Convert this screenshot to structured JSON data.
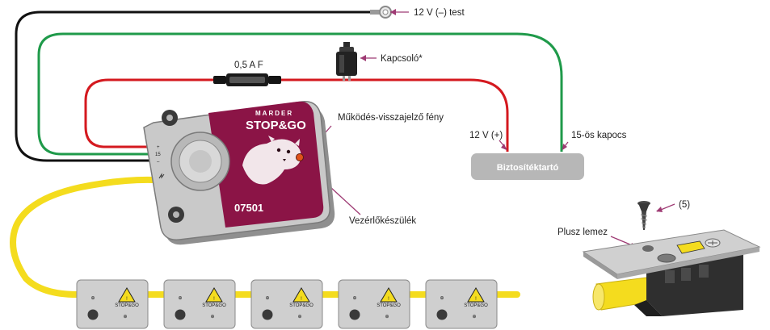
{
  "labels": {
    "test": "12 V (–) test",
    "fuse": "0,5 A F",
    "switch": "Kapcsoló*",
    "led": "Működés-visszajelző fény",
    "plus12": "12 V (+)",
    "terminal15": "15-ös kapocs",
    "fusebox": "Biztosítéktartó",
    "controller": "Vezérlőkészülék",
    "screw_count": "(5)",
    "plate": "Plusz lemez"
  },
  "device": {
    "brand_top": "MARDER",
    "brand_main": "STOP&GO",
    "model": "07501",
    "pin_plus": "+",
    "pin_15": "15",
    "pin_minus": "–"
  },
  "plates": {
    "items": [
      {
        "warn": "STOP&GO"
      },
      {
        "warn": "STOP&GO"
      },
      {
        "warn": "STOP&GO"
      },
      {
        "warn": "STOP&GO"
      },
      {
        "warn": "STOP&GO"
      }
    ]
  },
  "colors": {
    "wire_red": "#d4191f",
    "wire_green": "#1f9a4a",
    "wire_black": "#111111",
    "cable_yellow": "#f4dc1e",
    "brand_purple": "#8b1446",
    "leader_purple": "#9e3a73",
    "fusebox_gray": "#b7b7b7",
    "housing_gray": "#c9c9c9"
  }
}
